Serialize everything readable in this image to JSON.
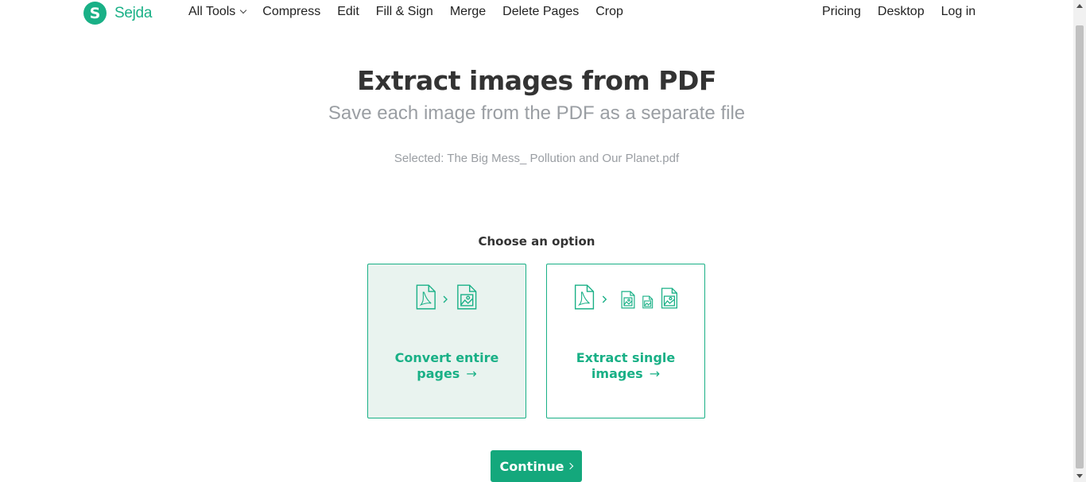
{
  "brand": {
    "logo_letter": "S",
    "name": "Sejda",
    "color": "#19b086"
  },
  "nav": {
    "all_tools": "All Tools",
    "items": [
      "Compress",
      "Edit",
      "Fill & Sign",
      "Merge",
      "Delete Pages",
      "Crop"
    ],
    "right": [
      "Pricing",
      "Desktop",
      "Log in"
    ]
  },
  "main": {
    "title": "Extract images from PDF",
    "subtitle": "Save each image from the PDF as a separate file",
    "selected": "Selected: The Big Mess_ Pollution and Our Planet.pdf",
    "choose": "Choose an option",
    "options": [
      {
        "label_line1": "Convert entire",
        "label_line2": "pages",
        "arrow": "→",
        "selected": true,
        "icons": [
          "pdf-file-icon",
          "chevron-right-icon",
          "image-file-icon"
        ]
      },
      {
        "label_line1": "Extract single",
        "label_line2": "images",
        "arrow": "→",
        "selected": false,
        "icons": [
          "pdf-file-icon",
          "chevron-right-icon",
          "image-file-icon",
          "image-file-icon",
          "image-file-icon"
        ]
      }
    ],
    "continue": "Continue"
  }
}
